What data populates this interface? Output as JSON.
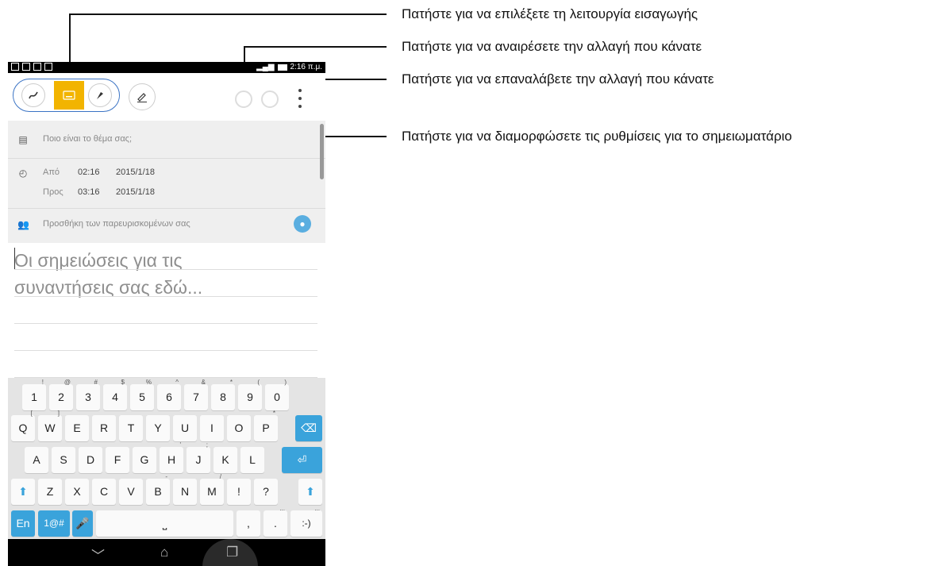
{
  "callouts": {
    "input_mode": "Πατήστε για να επιλέξετε τη λειτουργία εισαγωγής",
    "undo": "Πατήστε για να αναιρέσετε την αλλαγή που κάνατε",
    "redo": "Πατήστε για να επαναλάβετε την αλλαγή που κάνατε",
    "settings": "Πατήστε για να διαμορφώσετε τις ρυθμίσεις για το σημειωματάριο"
  },
  "status_bar": {
    "time": "2:16 π.μ."
  },
  "form": {
    "subject_placeholder": "Ποιο είναι το θέμα σας;",
    "from_label": "Από",
    "from_time": "02:16",
    "from_date": "2015/1/18",
    "to_label": "Προς",
    "to_time": "03:16",
    "to_date": "2015/1/18",
    "attendees_placeholder": "Προσθήκη των παρευρισκομένων σας"
  },
  "notes": {
    "placeholder_line1": "Οι σημειώσεις για τις",
    "placeholder_line2": "συναντήσεις σας εδώ..."
  },
  "keyboard": {
    "row1": [
      [
        "1",
        "!"
      ],
      [
        "2",
        "@"
      ],
      [
        "3",
        "#"
      ],
      [
        "4",
        "$"
      ],
      [
        "5",
        "%"
      ],
      [
        "6",
        "^"
      ],
      [
        "7",
        "&"
      ],
      [
        "8",
        "*"
      ],
      [
        "9",
        "("
      ],
      [
        "0",
        ")"
      ]
    ],
    "row2": [
      [
        "Q",
        "["
      ],
      [
        "W",
        "]"
      ],
      [
        "E",
        ""
      ],
      [
        "R",
        ""
      ],
      [
        "T",
        ""
      ],
      [
        "Y",
        ""
      ],
      [
        "U",
        ""
      ],
      [
        "I",
        ""
      ],
      [
        "O",
        ""
      ],
      [
        "P",
        "*"
      ]
    ],
    "row3": [
      [
        "A",
        ""
      ],
      [
        "S",
        ""
      ],
      [
        "D",
        ""
      ],
      [
        "F",
        ""
      ],
      [
        "G",
        ""
      ],
      [
        "H",
        "'"
      ],
      [
        "J",
        ";"
      ],
      [
        "K",
        ""
      ],
      [
        "L",
        ""
      ]
    ],
    "row4": [
      [
        "Z",
        ""
      ],
      [
        "X",
        ""
      ],
      [
        "C",
        ""
      ],
      [
        "V",
        ""
      ],
      [
        "B",
        "-"
      ],
      [
        "N",
        ""
      ],
      [
        "M",
        "/"
      ],
      [
        "!",
        ""
      ],
      [
        "?",
        ""
      ]
    ],
    "lang": "En",
    "symbols": "1@#",
    "comma": ",",
    "period": ".",
    "smiley": ":-)",
    "ellipsis": "..."
  },
  "colors": {
    "accent_blue": "#3aa3db",
    "mode_active": "#f2b400",
    "group_outline": "#3a73c4"
  },
  "icons": {
    "modes": [
      "handwriting-icon",
      "keyboard-icon",
      "brush-icon"
    ],
    "pen": "pen-settings-icon",
    "undo": "undo-icon",
    "redo": "redo-icon",
    "more": "more-vertical-icon"
  }
}
